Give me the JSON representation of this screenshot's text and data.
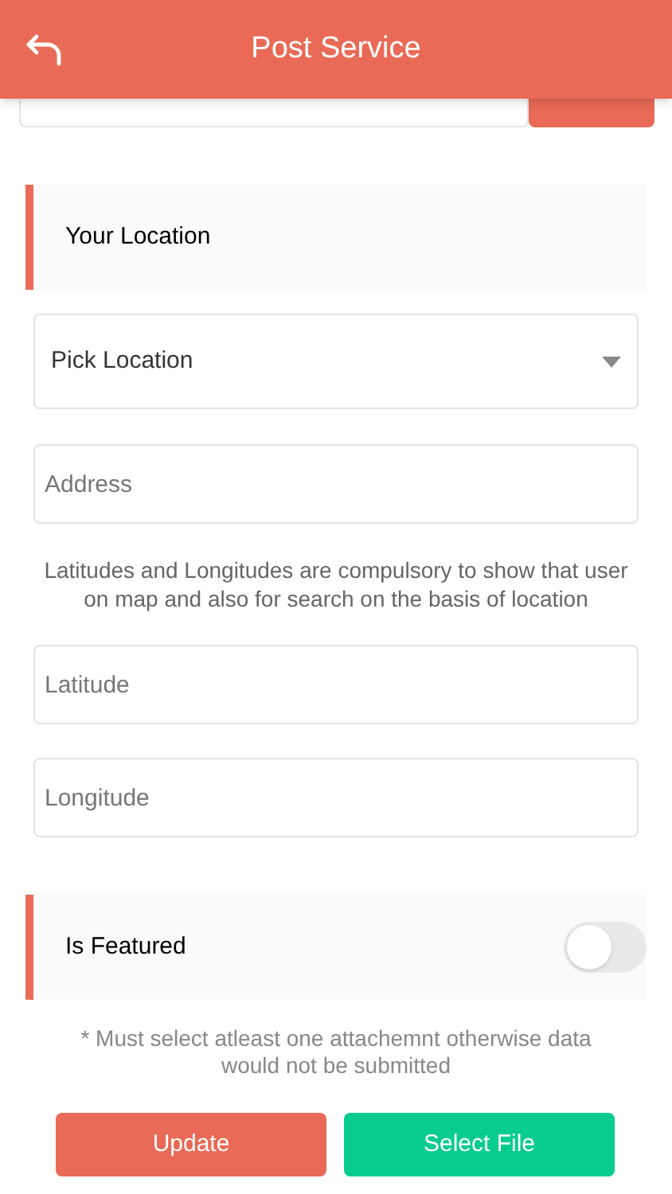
{
  "header": {
    "title": "Post Service"
  },
  "location_section": {
    "title": "Your Location"
  },
  "pick_location": {
    "placeholder": "Pick Location"
  },
  "address": {
    "placeholder": "Address"
  },
  "help_text": "Latitudes and Longitudes are compulsory to show that user on map and also for search on the basis of location",
  "latitude": {
    "placeholder": "Latitude"
  },
  "longitude": {
    "placeholder": "Longitude"
  },
  "featured": {
    "label": "Is Featured",
    "on": false
  },
  "note": "* Must select atleast one attachemnt otherwise data would not be submitted",
  "buttons": [
    {
      "label": "Update",
      "kind": "primary"
    },
    {
      "label": "Select File",
      "kind": "secondary"
    }
  ]
}
